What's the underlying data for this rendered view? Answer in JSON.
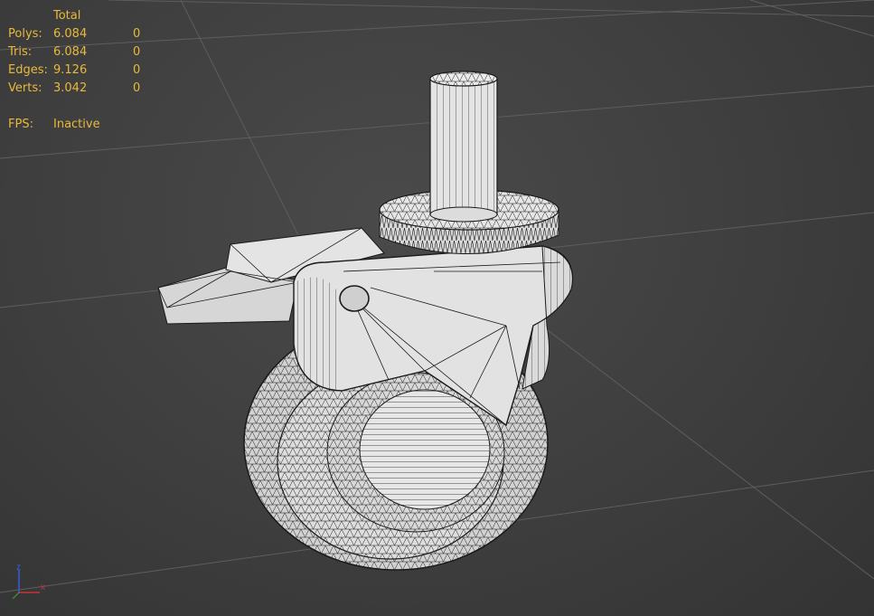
{
  "stats": {
    "header_total": "Total",
    "rows": [
      {
        "label": "Polys:",
        "total": "6.084",
        "selected": "0"
      },
      {
        "label": "Tris:",
        "total": "6.084",
        "selected": "0"
      },
      {
        "label": "Edges:",
        "total": "9.126",
        "selected": "0"
      },
      {
        "label": "Verts:",
        "total": "3.042",
        "selected": "0"
      }
    ],
    "fps_label": "FPS:",
    "fps_value": "Inactive"
  },
  "axis_gizmo": {
    "x_label": "x",
    "z_label": "z"
  },
  "colors": {
    "background": "#3d3d3d",
    "grid_line": "#5e5e5e",
    "stats_text": "#e8b93a",
    "model_face": "#d9d9d9",
    "model_wire": "#1a1a1a",
    "axis_x": "#c83232",
    "axis_z": "#3a5fd0"
  }
}
